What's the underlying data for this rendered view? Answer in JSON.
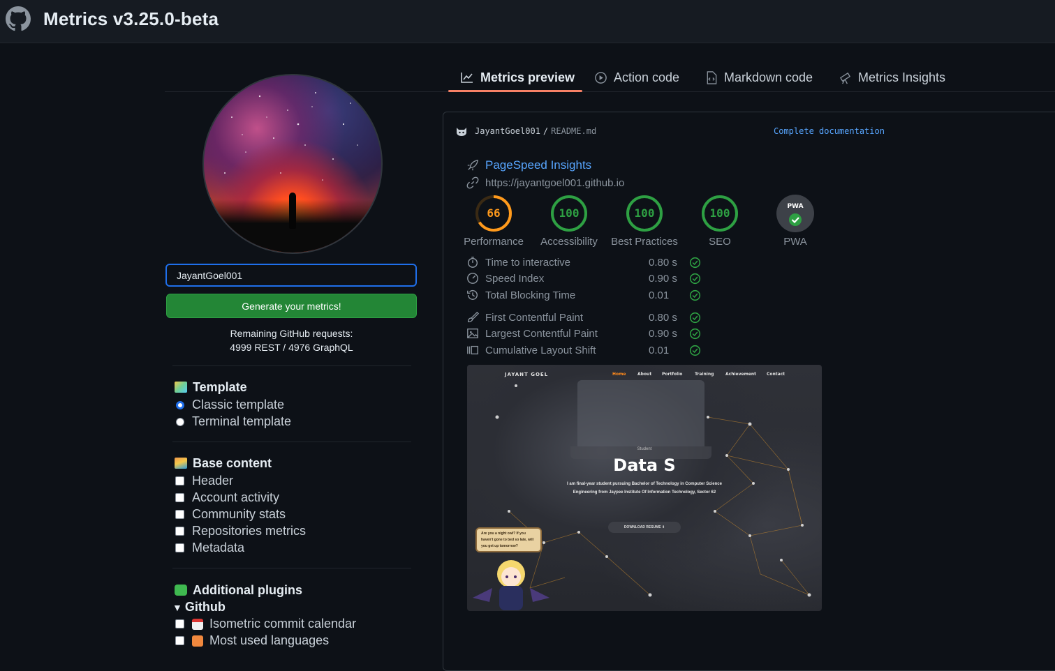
{
  "app": {
    "title": "Metrics v3.25.0-beta"
  },
  "tabs": [
    {
      "label": "Metrics preview",
      "icon": "graph-icon",
      "active": true
    },
    {
      "label": "Action code",
      "icon": "play-icon",
      "active": false
    },
    {
      "label": "Markdown code",
      "icon": "file-code-icon",
      "active": false
    },
    {
      "label": "Metrics Insights",
      "icon": "telescope-icon",
      "active": false
    }
  ],
  "sidebar": {
    "username_value": "JayantGoel001",
    "generate_label": "Generate your metrics!",
    "remaining_label": "Remaining GitHub requests:",
    "remaining_value": "4999 REST / 4976 GraphQL",
    "template": {
      "title": "Template",
      "options": [
        {
          "label": "Classic template",
          "checked": true
        },
        {
          "label": "Terminal template",
          "checked": false
        }
      ]
    },
    "base": {
      "title": "Base content",
      "options": [
        {
          "label": "Header",
          "checked": false
        },
        {
          "label": "Account activity",
          "checked": false
        },
        {
          "label": "Community stats",
          "checked": false
        },
        {
          "label": "Repositories metrics",
          "checked": false
        },
        {
          "label": "Metadata",
          "checked": false
        }
      ]
    },
    "plugins": {
      "title": "Additional plugins",
      "group": "Github",
      "options": [
        {
          "label": "Isometric commit calendar",
          "checked": false
        },
        {
          "label": "Most used languages",
          "checked": false
        }
      ]
    }
  },
  "preview": {
    "user": "JayantGoel001",
    "separator": "/",
    "file": "README.md",
    "doc_link": "Complete documentation",
    "pagespeed": {
      "title": "PageSpeed Insights",
      "url": "https://jayantgoel001.github.io",
      "scores": [
        {
          "value": "66",
          "label": "Performance",
          "color": "#ff9a1c",
          "fraction": 0.66
        },
        {
          "value": "100",
          "label": "Accessibility",
          "color": "#2ea043",
          "fraction": 1
        },
        {
          "value": "100",
          "label": "Best Practices",
          "color": "#2ea043",
          "fraction": 1
        },
        {
          "value": "100",
          "label": "SEO",
          "color": "#2ea043",
          "fraction": 1
        }
      ],
      "pwa": {
        "label": "PWA",
        "badge": "PWA"
      },
      "metrics": [
        {
          "name": "Time to interactive",
          "value": "0.80 s",
          "icon": "stopwatch-icon"
        },
        {
          "name": "Speed Index",
          "value": "0.90 s",
          "icon": "speed-icon"
        },
        {
          "name": "Total Blocking Time",
          "value": "0.01",
          "icon": "history-icon"
        },
        {
          "name": "First Contentful Paint",
          "value": "0.80 s",
          "icon": "paintbrush-icon"
        },
        {
          "name": "Largest Contentful Paint",
          "value": "0.90 s",
          "icon": "image-icon"
        },
        {
          "name": "Cumulative Layout Shift",
          "value": "0.01",
          "icon": "layout-icon"
        }
      ]
    },
    "screenshot": {
      "brand": "JAYANT GOEL",
      "nav": [
        "Home",
        "About",
        "Portfolio",
        "Training",
        "Achievement",
        "Contact"
      ],
      "kicker": "Student",
      "hero": "Data S",
      "desc": "I am final-year student pursuing Bachelor of Technology in Computer Science Engineering from Jaypee Institute Of Information Technology, Sector 62",
      "button": "DOWNLOAD RESUME ⬇",
      "bubble": "Are you a night owl? If you haven't gone to bed so late, will you get up tomorrow?"
    }
  }
}
